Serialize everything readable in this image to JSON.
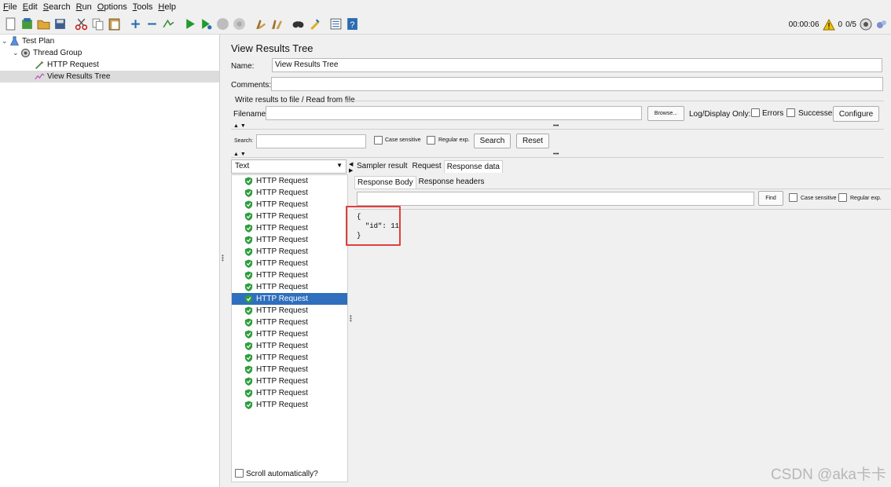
{
  "menu": {
    "items": [
      {
        "u": "F",
        "rest": "ile"
      },
      {
        "u": "E",
        "rest": "dit"
      },
      {
        "u": "S",
        "rest": "earch"
      },
      {
        "u": "R",
        "rest": "un"
      },
      {
        "u": "O",
        "rest": "ptions"
      },
      {
        "u": "T",
        "rest": "ools"
      },
      {
        "u": "H",
        "rest": "elp"
      }
    ]
  },
  "toolbar": {
    "timer": "00:00:06",
    "warnings": "0",
    "threads": "0/5"
  },
  "tree": {
    "test_plan": "Test Plan",
    "thread_group": "Thread Group",
    "http_request": "HTTP Request",
    "view_results_tree": "View Results Tree"
  },
  "panel": {
    "title": "View Results Tree",
    "name_label": "Name:",
    "name_value": "View Results Tree",
    "comments_label": "Comments:",
    "comments_value": "",
    "write_results_label": "Write results to file / Read from file",
    "filename_label": "Filename",
    "filename_value": "",
    "browse_label": "Browse...",
    "log_display_label": "Log/Display Only:",
    "errors_label": "Errors",
    "successes_label": "Successes",
    "configure_label": "Configure",
    "search_label": "Search:",
    "search_value": "",
    "case_sensitive_label": "Case sensitive",
    "regexp_label": "Regular exp.",
    "search_button": "Search",
    "reset_button": "Reset"
  },
  "results": {
    "renderer": "Text",
    "items": [
      "HTTP Request",
      "HTTP Request",
      "HTTP Request",
      "HTTP Request",
      "HTTP Request",
      "HTTP Request",
      "HTTP Request",
      "HTTP Request",
      "HTTP Request",
      "HTTP Request",
      "HTTP Request",
      "HTTP Request",
      "HTTP Request",
      "HTTP Request",
      "HTTP Request",
      "HTTP Request",
      "HTTP Request",
      "HTTP Request",
      "HTTP Request",
      "HTTP Request"
    ],
    "selected_index": 10,
    "scroll_auto_label": "Scroll automatically?"
  },
  "detail": {
    "tabs": [
      "Sampler result",
      "Request",
      "Response data"
    ],
    "active_tab": "Response data",
    "subtabs": [
      "Response Body",
      "Response headers"
    ],
    "active_subtab": "Response Body",
    "find_value": "",
    "find_button": "Find",
    "case_sensitive_label": "Case sensitive",
    "regexp_label": "Regular exp.",
    "body_lines": [
      "{",
      "  \"id\": 11",
      "}"
    ]
  },
  "watermark": "CSDN @aka卡卡",
  "colors": {
    "selection": "#2f6fbd",
    "highlight_box": "#e04040",
    "success_icon": "#2e9d3f"
  }
}
